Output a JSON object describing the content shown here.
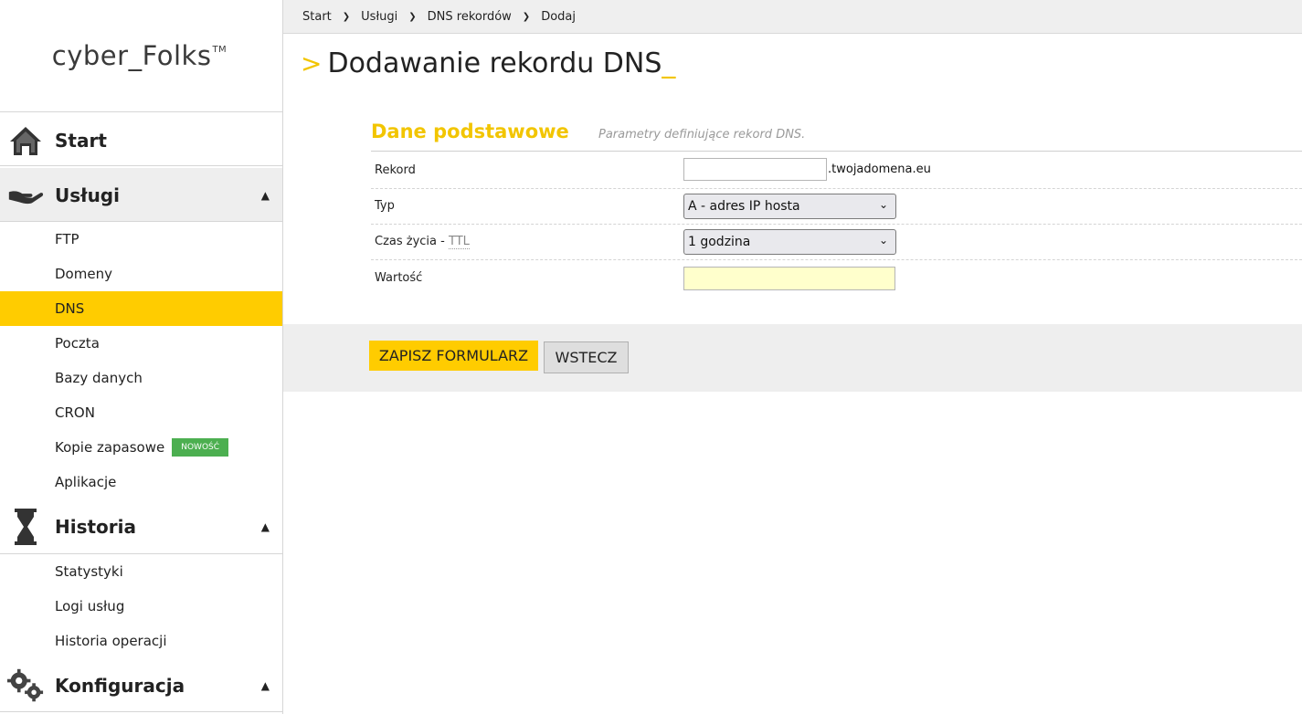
{
  "logo": {
    "text": "cyber_Folks",
    "tm": "TM"
  },
  "sidebar": {
    "start": {
      "label": "Start",
      "icon": "home-icon"
    },
    "uslugi": {
      "label": "Usługi",
      "icon": "hand-icon",
      "items": [
        {
          "label": "FTP"
        },
        {
          "label": "Domeny"
        },
        {
          "label": "DNS"
        },
        {
          "label": "Poczta"
        },
        {
          "label": "Bazy danych"
        },
        {
          "label": "CRON"
        },
        {
          "label": "Kopie zapasowe",
          "badge": "NOWOŚĆ"
        },
        {
          "label": "Aplikacje"
        }
      ]
    },
    "historia": {
      "label": "Historia",
      "icon": "hourglass-icon",
      "items": [
        {
          "label": "Statystyki"
        },
        {
          "label": "Logi usług"
        },
        {
          "label": "Historia operacji"
        }
      ]
    },
    "konfiguracja": {
      "label": "Konfiguracja",
      "icon": "gears-icon"
    },
    "active_item": "DNS"
  },
  "breadcrumb": [
    "Start",
    "Usługi",
    "DNS rekordów",
    "Dodaj"
  ],
  "page": {
    "title_prefix": ">",
    "title": "Dodawanie rekordu DNS",
    "title_suffix": "_"
  },
  "form": {
    "section_title": "Dane podstawowe",
    "section_desc": "Parametry definiujące rekord DNS.",
    "rekord": {
      "label": "Rekord",
      "value": "",
      "suffix": ".twojadomena.eu"
    },
    "typ": {
      "label": "Typ",
      "value": "A - adres IP hosta"
    },
    "ttl": {
      "label": "Czas życia - ",
      "abbr": "TTL",
      "value": "1 godzina"
    },
    "wartosc": {
      "label": "Wartość",
      "value": ""
    }
  },
  "buttons": {
    "save": "ZAPISZ FORMULARZ",
    "back": "WSTECZ"
  },
  "colors": {
    "accent": "#ffcc00",
    "badge": "#4caf50",
    "title_accent": "#f2c500"
  }
}
